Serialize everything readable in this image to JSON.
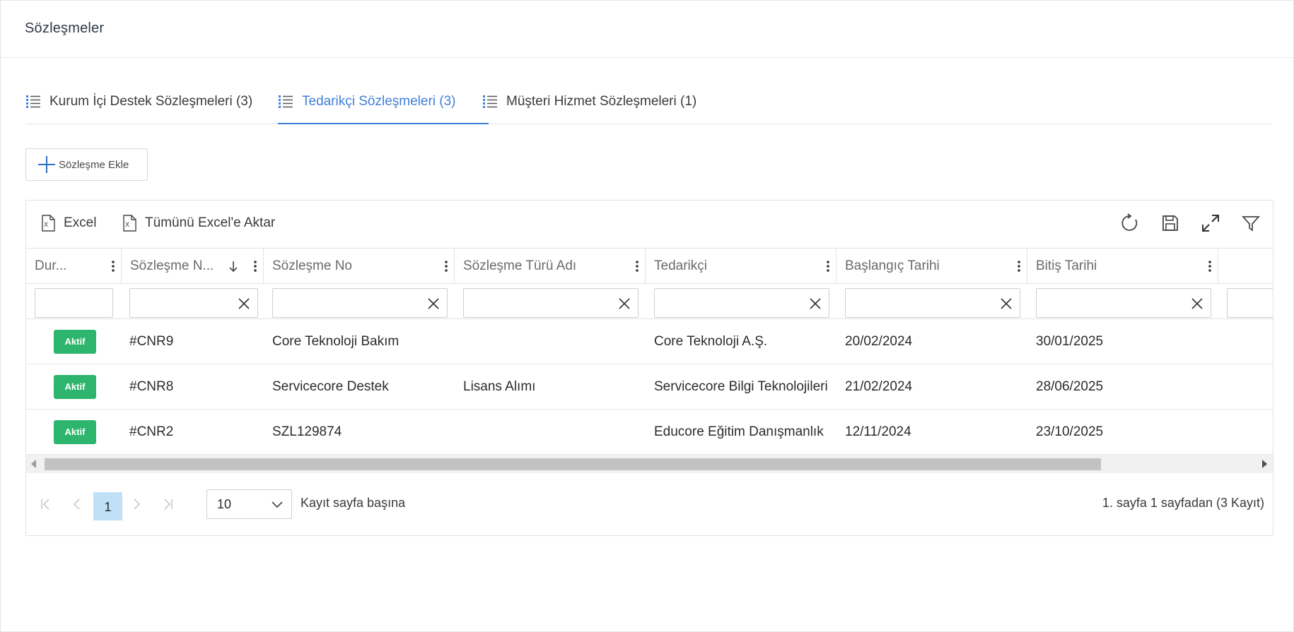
{
  "page": {
    "title": "Sözleşmeler"
  },
  "tabs": [
    {
      "label": "Kurum İçi Destek Sözleşmeleri (3)"
    },
    {
      "label": "Tedarikçi Sözleşmeleri (3)"
    },
    {
      "label": "Müşteri Hizmet Sözleşmeleri (1)"
    }
  ],
  "add_button": {
    "label": "Sözleşme Ekle"
  },
  "toolbar": {
    "excel_label": "Excel",
    "export_all_label": "Tümünü Excel'e Aktar",
    "icons": [
      "refresh-icon",
      "save-icon",
      "expand-icon",
      "filter-icon"
    ]
  },
  "columns": [
    {
      "label": "Dur..."
    },
    {
      "label": "Sözleşme N..."
    },
    {
      "label": "Sözleşme No"
    },
    {
      "label": "Sözleşme Türü Adı"
    },
    {
      "label": "Tedarikçi"
    },
    {
      "label": "Başlangıç Tarihi"
    },
    {
      "label": "Bitiş Tarihi"
    }
  ],
  "rows": [
    {
      "status": "Aktif",
      "ref": "#CNR9",
      "no": "Core Teknoloji Bakım",
      "type": "",
      "supplier": "Core Teknoloji A.Ş.",
      "start": "20/02/2024",
      "end": "30/01/2025"
    },
    {
      "status": "Aktif",
      "ref": "#CNR8",
      "no": "Servicecore Destek",
      "type": "Lisans Alımı",
      "supplier": "Servicecore Bilgi Teknolojileri",
      "start": "21/02/2024",
      "end": "28/06/2025"
    },
    {
      "status": "Aktif",
      "ref": "#CNR2",
      "no": "SZL129874",
      "type": "",
      "supplier": "Educore Eğitim Danışmanlık",
      "start": "12/11/2024",
      "end": "23/10/2025"
    }
  ],
  "pager": {
    "current_page": "1",
    "page_size": "10",
    "page_size_label": "Kayıt sayfa başına",
    "info": "1. sayfa 1 sayfadan (3 Kayıt)"
  },
  "colors": {
    "accent": "#3f7fd9",
    "status_active": "#2eb56d",
    "current_page_bg": "#bfe0f7"
  }
}
